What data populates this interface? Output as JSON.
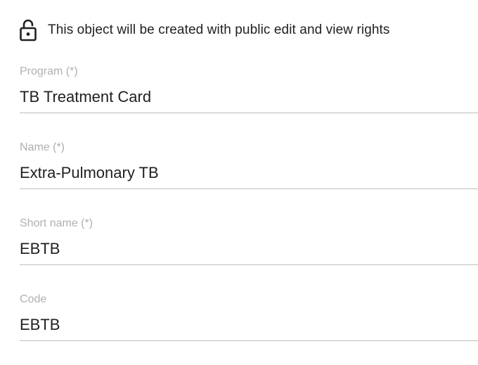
{
  "notice": {
    "icon": "lock-open-icon",
    "text": "This object will be created with public edit and view rights"
  },
  "fields": [
    {
      "label": "Program (*)",
      "value": "TB Treatment Card"
    },
    {
      "label": "Name (*)",
      "value": "Extra-Pulmonary TB"
    },
    {
      "label": "Short name (*)",
      "value": "EBTB"
    },
    {
      "label": "Code",
      "value": "EBTB"
    }
  ],
  "colors": {
    "label": "#b0b0b0",
    "text": "#212121",
    "underline": "#bdbdbd"
  }
}
